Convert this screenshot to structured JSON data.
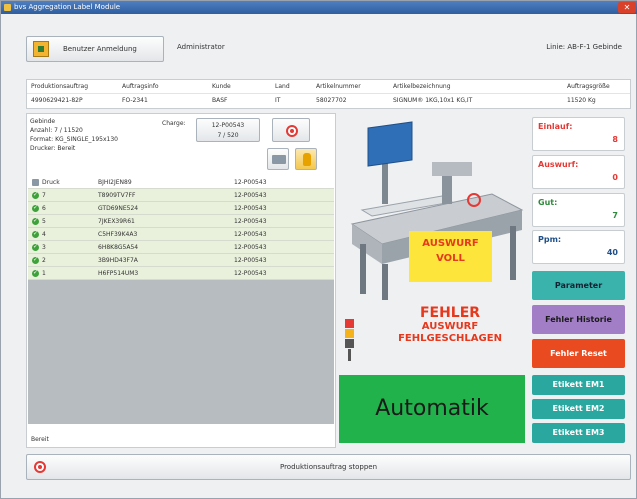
{
  "window": {
    "title": "bvs Aggregation Label Module"
  },
  "header": {
    "login_button": "Benutzer Anmeldung",
    "user": "Administrator",
    "line": "Linie: AB-F-1 Gebinde"
  },
  "order_table": {
    "columns": [
      "Produktionsauftrag",
      "Auftragsinfo",
      "Kunde",
      "Land",
      "Artikelnummer",
      "Artikelbezeichnung",
      "Auftragsgröße"
    ],
    "row": [
      "4990629421-82P",
      "FO-2341",
      "BASF",
      "IT",
      "58027702",
      "SIGNUM® 1KG,10x1 KG,IT",
      "11520 Kg"
    ]
  },
  "gebinde": {
    "title": "Gebinde",
    "anzahl": "Anzahl: 7 / 11520",
    "format": "Format: KG_SINGLE_195x130",
    "drucker": "Drucker: Bereit",
    "charge_label": "Charge:",
    "charge_line1": "12-P00543",
    "charge_line2": "7 / 520"
  },
  "list": {
    "header": {
      "c1": "Druck",
      "c2": "BJHI2JEN89",
      "c3": "12-P00543"
    },
    "rows": [
      {
        "c1": "7",
        "c2": "T8909TV7FF",
        "c3": "12-P00543"
      },
      {
        "c1": "6",
        "c2": "GTD69NE524",
        "c3": "12-P00543"
      },
      {
        "c1": "5",
        "c2": "7JKEX39R61",
        "c3": "12-P00543"
      },
      {
        "c1": "4",
        "c2": "C5HF39K4A3",
        "c3": "12-P00543"
      },
      {
        "c1": "3",
        "c2": "6H8K8G5A54",
        "c3": "12-P00543"
      },
      {
        "c1": "2",
        "c2": "3B9HD43F7A",
        "c3": "12-P00543"
      },
      {
        "c1": "1",
        "c2": "H6FP514UM3",
        "c3": "12-P00543"
      }
    ]
  },
  "status_bereit": "Bereit",
  "machine": {
    "warning_line1": "AUSWURF",
    "warning_line2": "VOLL"
  },
  "error": {
    "line1": "FEHLER",
    "line2": "AUSWURF",
    "line3": "FEHLGESCHLAGEN"
  },
  "mode": "Automatik",
  "counters": {
    "einlauf_label": "Einlauf:",
    "einlauf_value": "8",
    "auswurf_label": "Auswurf:",
    "auswurf_value": "0",
    "gut_label": "Gut:",
    "gut_value": "7",
    "ppm_label": "Ppm:",
    "ppm_value": "40"
  },
  "buttons": {
    "parameter": "Parameter",
    "fehler_historie": "Fehler Historie",
    "fehler_reset": "Fehler Reset",
    "etikett_em1": "Etikett EM1",
    "etikett_em2": "Etikett EM2",
    "etikett_em3": "Etikett EM3",
    "stop": "Produktionsauftrag stoppen"
  },
  "colors": {
    "parameter": "#3bb3ad",
    "fehler_historie": "#a27ec6",
    "fehler_reset": "#e94a1f",
    "etikett": "#2aa8a0",
    "automatik": "#22b24c",
    "counter_text": "#e53935",
    "gut_text": "#2e8b3b"
  }
}
